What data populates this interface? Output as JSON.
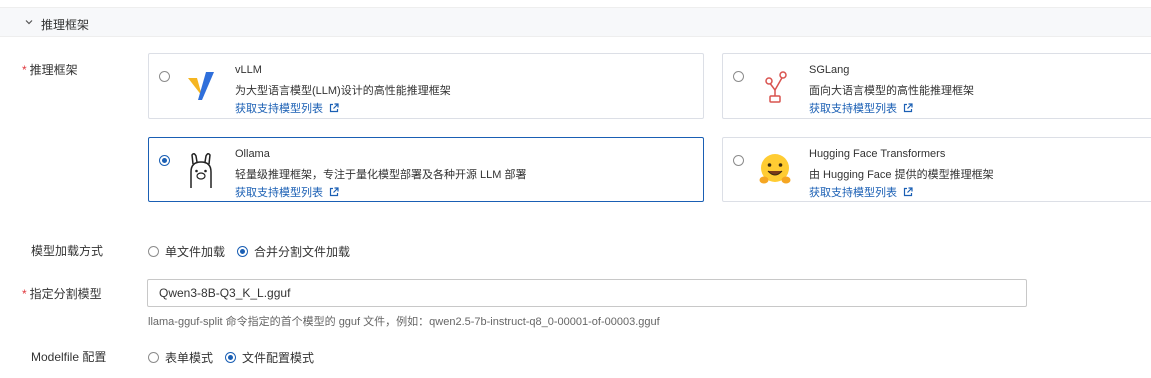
{
  "section": {
    "title": "推理框架"
  },
  "framework": {
    "label": "推理框架",
    "options": [
      {
        "name": "vLLM",
        "desc": "为大型语言模型(LLM)设计的高性能推理框架",
        "link": "获取支持模型列表",
        "selected": false
      },
      {
        "name": "SGLang",
        "desc": "面向大语言模型的高性能推理框架",
        "link": "获取支持模型列表",
        "selected": false
      },
      {
        "name": "Ollama",
        "desc": "轻量级推理框架，专注于量化模型部署及各种开源 LLM 部署",
        "link": "获取支持模型列表",
        "selected": true
      },
      {
        "name": "Hugging Face Transformers",
        "desc": "由 Hugging Face 提供的模型推理框架",
        "link": "获取支持模型列表",
        "selected": false
      }
    ]
  },
  "load_method": {
    "label": "模型加载方式",
    "options": [
      "单文件加载",
      "合并分割文件加载"
    ],
    "selected": "合并分割文件加载"
  },
  "split_model": {
    "label": "指定分割模型",
    "value": "Qwen3-8B-Q3_K_L.gguf",
    "help": "llama-gguf-split 命令指定的首个模型的 gguf 文件，例如：qwen2.5-7b-instruct-q8_0-00001-of-00003.gguf"
  },
  "modelfile": {
    "label": "Modelfile 配置",
    "options": [
      "表单模式",
      "文件配置模式"
    ],
    "selected": "文件配置模式"
  },
  "colors": {
    "accent": "#1a5fb4",
    "required": "#e0383e",
    "vllm_blue": "#2f6fdb",
    "vllm_yellow": "#f5b521",
    "sglang_red": "#d9534f",
    "hf_yellow": "#ffcc33"
  },
  "icons": {
    "collapse": "chevron-down-icon",
    "external": "external-link-icon"
  }
}
